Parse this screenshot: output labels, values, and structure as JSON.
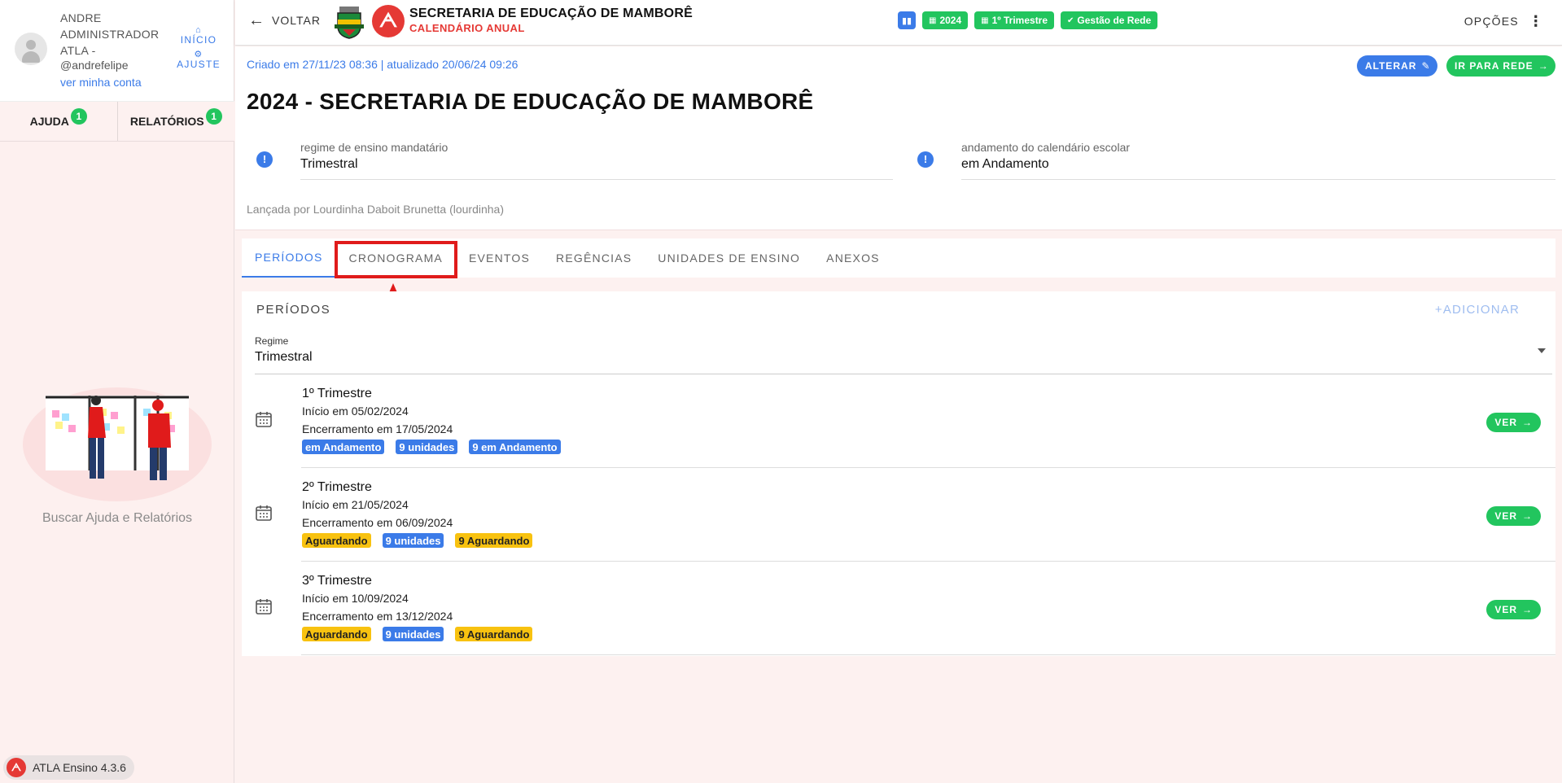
{
  "user": {
    "name": "ANDRE ADMINISTRADOR ATLA -",
    "handle": "@andrefelipe",
    "account_link": "ver minha conta"
  },
  "side_nav": {
    "home": "INÍCIO",
    "settings": "AJUSTE"
  },
  "help_tabs": [
    {
      "label": "AJUDA",
      "badge": "1"
    },
    {
      "label": "RELATÓRIOS",
      "badge": "1"
    }
  ],
  "help_text": "Buscar Ajuda e Relatórios",
  "version": "ATLA Ensino 4.3.6",
  "topbar": {
    "back": "VOLTAR",
    "brand_title": "SECRETARIA DE EDUCAÇÃO DE MAMBORÊ",
    "brand_subtitle": "CALENDÁRIO ANUAL",
    "chips": [
      "2024",
      "1º Trimestre",
      "Gestão de Rede"
    ],
    "options": "OPÇÕES"
  },
  "header": {
    "created": "Criado em 27/11/23 08:36 | atualizado 20/06/24 09:26",
    "edit_button": "ALTERAR",
    "network_button": "IR PARA REDE",
    "title": "2024 - SECRETARIA DE EDUCAÇÃO DE MAMBORÊ",
    "field_regime_label": "regime de ensino mandatário",
    "field_regime_value": "Trimestral",
    "field_status_label": "andamento do calendário escolar",
    "field_status_value": "em Andamento",
    "launched_by": "Lançada por Lourdinha Daboit Brunetta (lourdinha)"
  },
  "tabs": [
    "PERÍODOS",
    "CRONOGRAMA",
    "EVENTOS",
    "REGÊNCIAS",
    "UNIDADES DE ENSINO",
    "ANEXOS"
  ],
  "periods": {
    "heading": "PERÍODOS",
    "add": "ADICIONAR",
    "regime_label": "Regime",
    "regime_value": "Trimestral",
    "view_label": "VER",
    "items": [
      {
        "name": "1º Trimestre",
        "start": "Início em 05/02/2024",
        "end": "Encerramento em 17/05/2024",
        "tag1": "em Andamento",
        "tag2": "9 unidades",
        "tag3": "9 em Andamento"
      },
      {
        "name": "2º Trimestre",
        "start": "Início em 21/05/2024",
        "end": "Encerramento em 06/09/2024",
        "tag1": "Aguardando",
        "tag2": "9 unidades",
        "tag3": "9 Aguardando"
      },
      {
        "name": "3º Trimestre",
        "start": "Início em 10/09/2024",
        "end": "Encerramento em 13/12/2024",
        "tag1": "Aguardando",
        "tag2": "9 unidades",
        "tag3": "9 Aguardando"
      }
    ]
  },
  "colors": {
    "accent_blue": "#3b7be8",
    "accent_green": "#22c55e",
    "brand_red": "#e53935",
    "status_yellow": "#f8c210"
  }
}
